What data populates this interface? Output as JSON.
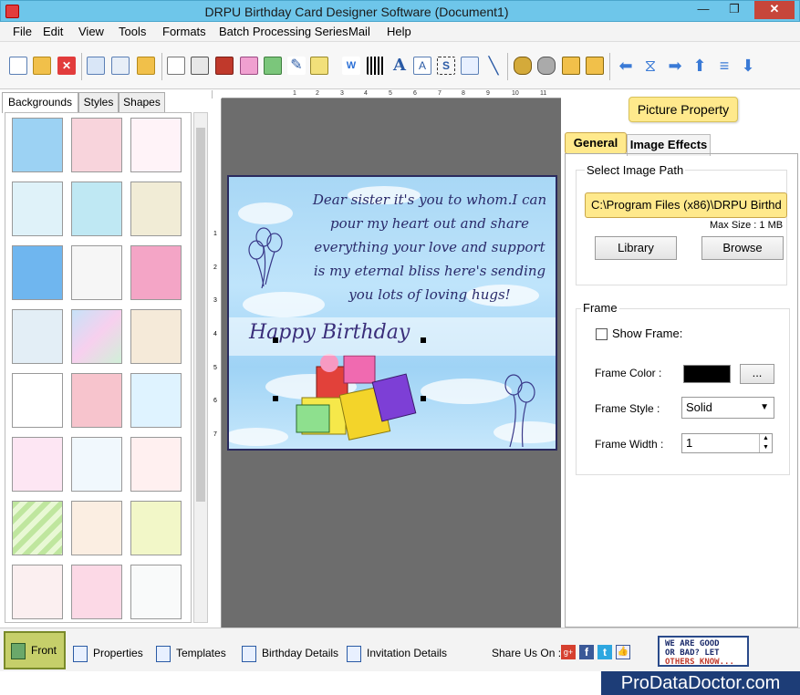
{
  "window": {
    "title": "DRPU Birthday Card Designer Software (Document1)"
  },
  "menu": [
    "File",
    "Edit",
    "View",
    "Tools",
    "Formats",
    "Batch Processing Series",
    "Mail",
    "Help"
  ],
  "left_tabs": [
    "Backgrounds",
    "Styles",
    "Shapes"
  ],
  "ruler_marks": [
    "1",
    "2",
    "3",
    "4",
    "5",
    "6",
    "7",
    "8",
    "9",
    "10",
    "11"
  ],
  "vruler_marks": [
    "1",
    "2",
    "3",
    "4",
    "5",
    "6",
    "7"
  ],
  "card": {
    "message": "Dear sister it's you to whom.I can pour my heart out and share everything your love and support is my eternal bliss here's sending you lots of loving hugs!",
    "headline": "Happy Birthday"
  },
  "right": {
    "picture_property": "Picture Property",
    "tab_general": "General",
    "tab_effects": "Image Effects",
    "select_path_title": "Select Image Path",
    "path_value": "C:\\Program Files (x86)\\DRPU Birthd",
    "max_size": "Max Size : 1 MB",
    "library": "Library",
    "browse": "Browse",
    "frame_title": "Frame",
    "show_frame": "Show Frame:",
    "frame_color": "Frame Color :",
    "ellipsis": "...",
    "frame_style": "Frame Style :",
    "frame_style_value": "Solid",
    "frame_width": "Frame Width :",
    "frame_width_value": "1"
  },
  "bottom": {
    "front": "Front",
    "properties": "Properties",
    "templates": "Templates",
    "birthday_details": "Birthday Details",
    "invitation_details": "Invitation Details",
    "share": "Share Us On :",
    "badge_line1": "WE ARE GOOD",
    "badge_line2": "OR BAD? LET",
    "badge_line3": "OTHERS KNOW..."
  },
  "watermark": "ProDataDoctor.com",
  "colors": {
    "title_bg": "#6ec6ea",
    "accent_yellow": "#ffe98c",
    "canvas_bg": "#6d6d6d",
    "frame_color": "#000000"
  }
}
